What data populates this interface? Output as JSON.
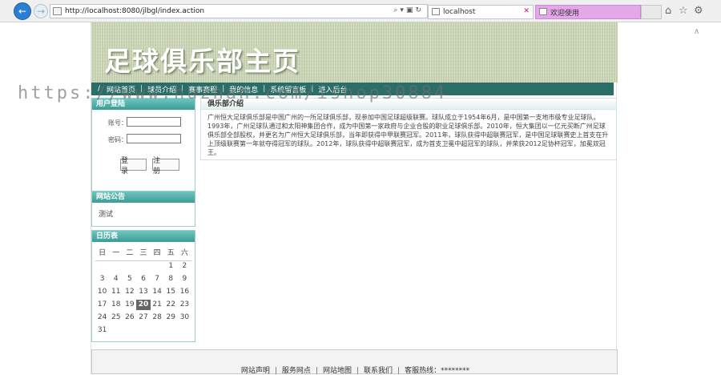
{
  "browser": {
    "url": "http://localhost:8080/jlbgl/index.action",
    "tabs": [
      {
        "label": "localhost",
        "active": true
      },
      {
        "label": "欢迎使用",
        "active": false
      }
    ],
    "accent": "#2a7fd4"
  },
  "banner": {
    "title": "足球俱乐部主页"
  },
  "nav": {
    "items": [
      "网站首页",
      "球员介绍",
      "赛事赛程",
      "我的信息",
      "系统留言板",
      "进入后台"
    ]
  },
  "login": {
    "title": "用户登陆",
    "account_label": "账号：",
    "password_label": "密码：",
    "account_value": "",
    "password_value": "",
    "login_button": "登 录",
    "register_button": "注 册"
  },
  "notice": {
    "title": "网站公告",
    "items": [
      "测试"
    ]
  },
  "calendar": {
    "title": "日历表",
    "weekdays": [
      "日",
      "一",
      "二",
      "三",
      "四",
      "五",
      "六"
    ],
    "leading_blanks": 5,
    "days_in_month": 31,
    "today": 20
  },
  "content": {
    "title": "俱乐部介绍",
    "body": "广州恒大足球俱乐部是中国广州的一所足球俱乐部，现参加中国足球超级联赛。球队成立于1954年6月，是中国第一支地市级专业足球队。1993年，广州足球队通过和太阳神集团合作，成为中国第一家政府与企业合股的职业足球俱乐部。2010年，恒大集团以一亿元买断广州足球俱乐部全部股权，并更名为广州恒大足球俱乐部，当年即获得中甲联赛冠军。2011年，球队获得中超联赛冠军，是中国足球联赛史上首支在升上顶级联赛第一年就夺得冠军的球队。2012年，球队获得中超联赛冠军，成为首支卫冕中超冠军的球队，并荣获2012足协杯冠军，加冕双冠王。"
  },
  "footer": {
    "links": [
      "网站声明",
      "服务网点",
      "网站地图",
      "联系我们"
    ],
    "hotline": "客服热线：********"
  },
  "watermark": "https://www.huzhan.com/ishop30884"
}
